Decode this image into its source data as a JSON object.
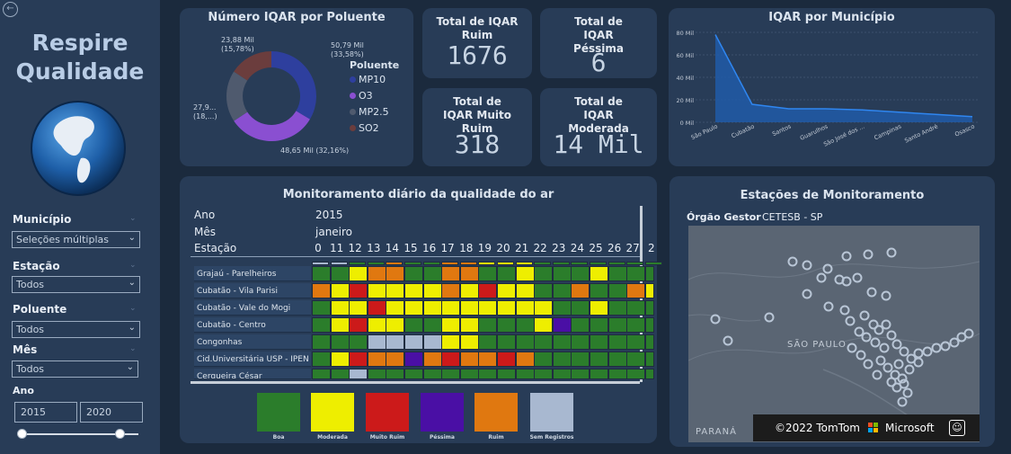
{
  "sidebar": {
    "back_icon": "arrow-left-icon",
    "title_line1": "Respire",
    "title_line2": "Qualidade",
    "filters": {
      "municipio": {
        "label": "Município",
        "value": "Seleções múltiplas"
      },
      "estacao": {
        "label": "Estação",
        "value": "Todos"
      },
      "poluente": {
        "label": "Poluente",
        "value": "Todos"
      },
      "mes": {
        "label": "Mês",
        "value": "Todos"
      },
      "ano": {
        "label": "Ano",
        "from": "2015",
        "to": "2020"
      }
    }
  },
  "donut": {
    "title": "Número IQAR por Poluente",
    "legend_title": "Poluente",
    "legend": [
      {
        "name": "MP10",
        "color": "#2e3f9e"
      },
      {
        "name": "O3",
        "color": "#8a4fd1"
      },
      {
        "name": "MP2.5",
        "color": "#4f5a6e"
      },
      {
        "name": "SO2",
        "color": "#6b3d3d"
      }
    ],
    "labels": {
      "mp10": [
        "50,79 Mil",
        "(33,58%)"
      ],
      "o3": "48,65 Mil (32,16%)",
      "mp25": [
        "27,9...",
        "(18,...)"
      ],
      "so2": [
        "23,88 Mil",
        "(15,78%)"
      ]
    }
  },
  "chart_data": {
    "type": "pie",
    "title": "Número IQAR por Poluente",
    "categories": [
      "MP10",
      "O3",
      "MP2.5",
      "SO2"
    ],
    "values": [
      33.58,
      32.16,
      18.48,
      15.78
    ]
  },
  "kpis": {
    "ruim": {
      "title": "Total de IQAR Ruim",
      "value": "1676"
    },
    "pessima": {
      "title": "Total de IQAR Péssima",
      "value": "6"
    },
    "muito_ruim": {
      "title": "Total de IQAR Muito Ruim",
      "value": "318"
    },
    "moderada": {
      "title": "Total de IQAR Moderada",
      "value": "14 Mil"
    }
  },
  "area_chart": {
    "title": "IQAR por Município",
    "yticks": [
      "80 Mil",
      "60 Mil",
      "40 Mil",
      "20 Mil",
      "0 Mil"
    ],
    "categories": [
      "São Paulo",
      "Cubatão",
      "Santos",
      "Guarulhos",
      "São José dos ...",
      "Campinas",
      "Santo André",
      "Osasco"
    ],
    "values": [
      78,
      16,
      12,
      12,
      11,
      9,
      7,
      5
    ]
  },
  "monitor": {
    "title": "Monitoramento diário da qualidade do ar",
    "ano_label": "Ano",
    "ano_value": "2015",
    "mes_label": "Mês",
    "mes_value": "janeiro",
    "estacao_label": "Estação",
    "days": [
      "0",
      "11",
      "12",
      "13",
      "14",
      "15",
      "16",
      "17",
      "18",
      "19",
      "20",
      "21",
      "22",
      "23",
      "24",
      "25",
      "26",
      "27",
      "2"
    ],
    "rows": [
      {
        "name": "Grajaú - Parelheiros",
        "cells": "GGYOOGGOOGGYGGGYGGG"
      },
      {
        "name": "Cubatão - Vila Parisi",
        "cells": "OYRYYYYOYRYYGGOGGOY"
      },
      {
        "name": "Cubatão - Vale do Mogi",
        "cells": "GYYRYYYYYYYYYGGYGGG"
      },
      {
        "name": "Cubatão - Centro",
        "cells": "GYRYYGGYYGGGYPGGGGG"
      },
      {
        "name": "Congonhas",
        "cells": "GGGLLLLYYGGGGGGGGGG"
      },
      {
        "name": "Cid.Universitária USP - IPEN",
        "cells": "GYROOPOROOROGGGGGGG"
      },
      {
        "name": "Cerqueira César",
        "cells": "GGLGGGGGGGGGGGGGGGG"
      }
    ],
    "scale": [
      {
        "label": "Boa",
        "color": "#2b7d2b"
      },
      {
        "label": "Moderada",
        "color": "#eeee00"
      },
      {
        "label": "Muito Ruim",
        "color": "#cc1a1a"
      },
      {
        "label": "Péssima",
        "color": "#4a0fa5"
      },
      {
        "label": "Ruim",
        "color": "#e07810"
      },
      {
        "label": "Sem Registros",
        "color": "#a8b8d0"
      }
    ]
  },
  "map": {
    "title": "Estações de Monitoramento",
    "filter_label": "Órgão Gestor",
    "filter_value": "CETESB - SP",
    "place_label": "SÃO PAULO",
    "place_label2": "PARANÁ",
    "attribution": "©2022 TomTom",
    "provider": "Microsoft",
    "feedback_icon": "smiley-icon"
  }
}
